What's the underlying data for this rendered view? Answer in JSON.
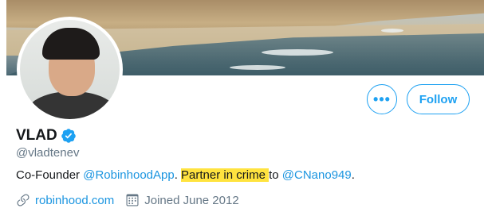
{
  "profile": {
    "name": "VLAD",
    "handle": "@vladtenev",
    "bio": {
      "part1": "Co-Founder ",
      "mention1": "@RobinhoodApp",
      "part2": ". ",
      "highlight": "Partner in crime ",
      "part3": "to ",
      "mention2": "@CNano949",
      "part4": "."
    },
    "website": "robinhood.com",
    "joined": "Joined June 2012"
  },
  "actions": {
    "more_label": "•••",
    "follow_label": "Follow"
  },
  "icons": {
    "verified": "verified-badge-icon",
    "link": "link-icon",
    "calendar": "calendar-icon",
    "more": "more-icon"
  },
  "colors": {
    "accent": "#1da1f2",
    "link": "#1b95e0",
    "muted": "#657786",
    "highlight": "#ffe33f"
  }
}
